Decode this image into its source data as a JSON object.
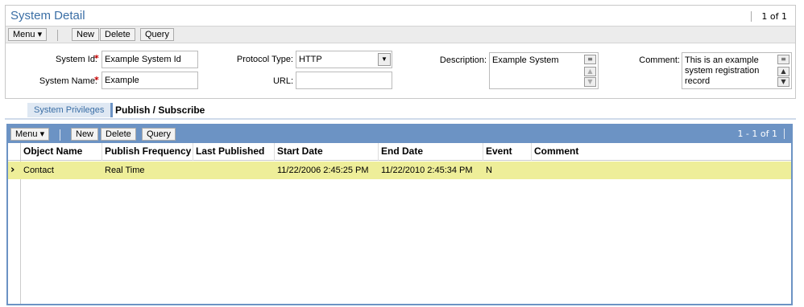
{
  "detail": {
    "title": "System Detail",
    "record_count": "1 of 1",
    "toolbar": {
      "menu": "Menu ▾",
      "new": "New",
      "delete": "Delete",
      "query": "Query"
    },
    "fields": {
      "system_id": {
        "label": "System Id:",
        "value": "Example System Id"
      },
      "system_name": {
        "label": "System Name:",
        "value": "Example"
      },
      "protocol_type": {
        "label": "Protocol Type:",
        "value": "HTTP"
      },
      "url": {
        "label": "URL:",
        "value": ""
      },
      "description": {
        "label": "Description:",
        "value": "Example System"
      },
      "comment": {
        "label": "Comment:",
        "value": "This is an example system registration record"
      }
    },
    "required_marker": "*"
  },
  "tabs": [
    {
      "label": "System Privileges"
    },
    {
      "label": "Publish / Subscribe"
    }
  ],
  "list": {
    "record_count": "1 - 1 of 1",
    "toolbar": {
      "menu": "Menu ▾",
      "new": "New",
      "delete": "Delete",
      "query": "Query"
    },
    "columns": [
      "Object Name",
      "Publish Frequency",
      "Last Published",
      "Start Date",
      "End Date",
      "Event",
      "Comment"
    ],
    "rows": [
      {
        "object_name": "Contact",
        "publish_frequency": "Real Time",
        "last_published": "",
        "start_date": "11/22/2006 2:45:25 PM",
        "end_date": "11/22/2010 2:45:34 PM",
        "event": "N",
        "comment": ""
      }
    ]
  }
}
